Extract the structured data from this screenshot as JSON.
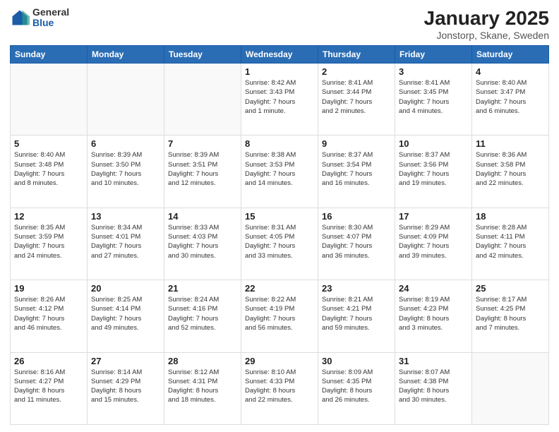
{
  "logo": {
    "general": "General",
    "blue": "Blue"
  },
  "title": "January 2025",
  "subtitle": "Jonstorp, Skane, Sweden",
  "weekdays": [
    "Sunday",
    "Monday",
    "Tuesday",
    "Wednesday",
    "Thursday",
    "Friday",
    "Saturday"
  ],
  "weeks": [
    [
      {
        "day": "",
        "info": ""
      },
      {
        "day": "",
        "info": ""
      },
      {
        "day": "",
        "info": ""
      },
      {
        "day": "1",
        "info": "Sunrise: 8:42 AM\nSunset: 3:43 PM\nDaylight: 7 hours\nand 1 minute."
      },
      {
        "day": "2",
        "info": "Sunrise: 8:41 AM\nSunset: 3:44 PM\nDaylight: 7 hours\nand 2 minutes."
      },
      {
        "day": "3",
        "info": "Sunrise: 8:41 AM\nSunset: 3:45 PM\nDaylight: 7 hours\nand 4 minutes."
      },
      {
        "day": "4",
        "info": "Sunrise: 8:40 AM\nSunset: 3:47 PM\nDaylight: 7 hours\nand 6 minutes."
      }
    ],
    [
      {
        "day": "5",
        "info": "Sunrise: 8:40 AM\nSunset: 3:48 PM\nDaylight: 7 hours\nand 8 minutes."
      },
      {
        "day": "6",
        "info": "Sunrise: 8:39 AM\nSunset: 3:50 PM\nDaylight: 7 hours\nand 10 minutes."
      },
      {
        "day": "7",
        "info": "Sunrise: 8:39 AM\nSunset: 3:51 PM\nDaylight: 7 hours\nand 12 minutes."
      },
      {
        "day": "8",
        "info": "Sunrise: 8:38 AM\nSunset: 3:53 PM\nDaylight: 7 hours\nand 14 minutes."
      },
      {
        "day": "9",
        "info": "Sunrise: 8:37 AM\nSunset: 3:54 PM\nDaylight: 7 hours\nand 16 minutes."
      },
      {
        "day": "10",
        "info": "Sunrise: 8:37 AM\nSunset: 3:56 PM\nDaylight: 7 hours\nand 19 minutes."
      },
      {
        "day": "11",
        "info": "Sunrise: 8:36 AM\nSunset: 3:58 PM\nDaylight: 7 hours\nand 22 minutes."
      }
    ],
    [
      {
        "day": "12",
        "info": "Sunrise: 8:35 AM\nSunset: 3:59 PM\nDaylight: 7 hours\nand 24 minutes."
      },
      {
        "day": "13",
        "info": "Sunrise: 8:34 AM\nSunset: 4:01 PM\nDaylight: 7 hours\nand 27 minutes."
      },
      {
        "day": "14",
        "info": "Sunrise: 8:33 AM\nSunset: 4:03 PM\nDaylight: 7 hours\nand 30 minutes."
      },
      {
        "day": "15",
        "info": "Sunrise: 8:31 AM\nSunset: 4:05 PM\nDaylight: 7 hours\nand 33 minutes."
      },
      {
        "day": "16",
        "info": "Sunrise: 8:30 AM\nSunset: 4:07 PM\nDaylight: 7 hours\nand 36 minutes."
      },
      {
        "day": "17",
        "info": "Sunrise: 8:29 AM\nSunset: 4:09 PM\nDaylight: 7 hours\nand 39 minutes."
      },
      {
        "day": "18",
        "info": "Sunrise: 8:28 AM\nSunset: 4:11 PM\nDaylight: 7 hours\nand 42 minutes."
      }
    ],
    [
      {
        "day": "19",
        "info": "Sunrise: 8:26 AM\nSunset: 4:12 PM\nDaylight: 7 hours\nand 46 minutes."
      },
      {
        "day": "20",
        "info": "Sunrise: 8:25 AM\nSunset: 4:14 PM\nDaylight: 7 hours\nand 49 minutes."
      },
      {
        "day": "21",
        "info": "Sunrise: 8:24 AM\nSunset: 4:16 PM\nDaylight: 7 hours\nand 52 minutes."
      },
      {
        "day": "22",
        "info": "Sunrise: 8:22 AM\nSunset: 4:19 PM\nDaylight: 7 hours\nand 56 minutes."
      },
      {
        "day": "23",
        "info": "Sunrise: 8:21 AM\nSunset: 4:21 PM\nDaylight: 7 hours\nand 59 minutes."
      },
      {
        "day": "24",
        "info": "Sunrise: 8:19 AM\nSunset: 4:23 PM\nDaylight: 8 hours\nand 3 minutes."
      },
      {
        "day": "25",
        "info": "Sunrise: 8:17 AM\nSunset: 4:25 PM\nDaylight: 8 hours\nand 7 minutes."
      }
    ],
    [
      {
        "day": "26",
        "info": "Sunrise: 8:16 AM\nSunset: 4:27 PM\nDaylight: 8 hours\nand 11 minutes."
      },
      {
        "day": "27",
        "info": "Sunrise: 8:14 AM\nSunset: 4:29 PM\nDaylight: 8 hours\nand 15 minutes."
      },
      {
        "day": "28",
        "info": "Sunrise: 8:12 AM\nSunset: 4:31 PM\nDaylight: 8 hours\nand 18 minutes."
      },
      {
        "day": "29",
        "info": "Sunrise: 8:10 AM\nSunset: 4:33 PM\nDaylight: 8 hours\nand 22 minutes."
      },
      {
        "day": "30",
        "info": "Sunrise: 8:09 AM\nSunset: 4:35 PM\nDaylight: 8 hours\nand 26 minutes."
      },
      {
        "day": "31",
        "info": "Sunrise: 8:07 AM\nSunset: 4:38 PM\nDaylight: 8 hours\nand 30 minutes."
      },
      {
        "day": "",
        "info": ""
      }
    ]
  ]
}
